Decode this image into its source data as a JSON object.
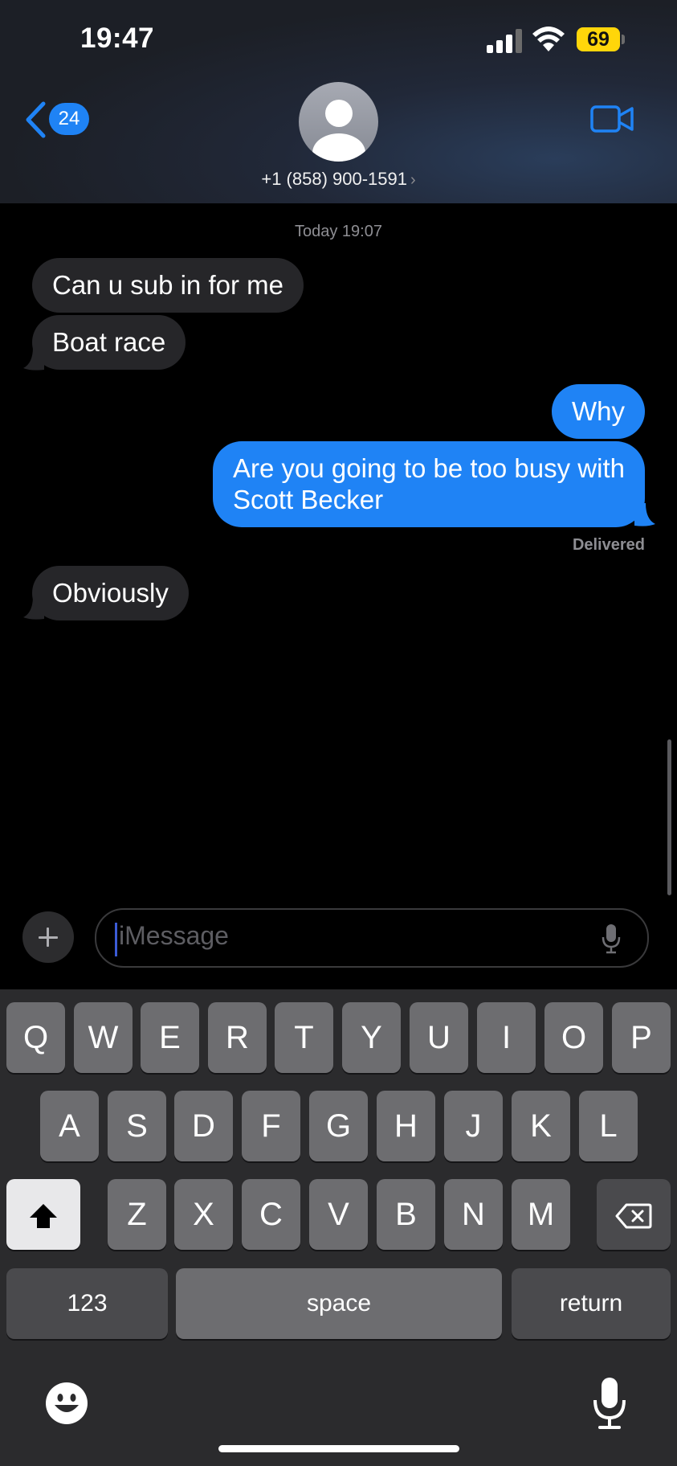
{
  "status_bar": {
    "time": "19:47",
    "battery": "69"
  },
  "nav": {
    "back_count": "24",
    "contact": "+1 (858) 900-1591",
    "chevron": "›"
  },
  "conversation": {
    "timestamp": "Today 19:07",
    "messages": [
      {
        "direction": "received",
        "text": "Can u sub in for me"
      },
      {
        "direction": "received",
        "text": "Boat race"
      },
      {
        "direction": "sent",
        "text": "Why"
      },
      {
        "direction": "sent",
        "text_line1": "Are you going to be too busy with",
        "text_line2": "Scott Becker"
      },
      {
        "direction": "received",
        "text": "Obviously"
      }
    ],
    "status": "Delivered"
  },
  "composer": {
    "placeholder": "iMessage"
  },
  "keyboard": {
    "row1": [
      "Q",
      "W",
      "E",
      "R",
      "T",
      "Y",
      "U",
      "I",
      "O",
      "P"
    ],
    "row2": [
      "A",
      "S",
      "D",
      "F",
      "G",
      "H",
      "J",
      "K",
      "L"
    ],
    "row3": [
      "Z",
      "X",
      "C",
      "V",
      "B",
      "N",
      "M"
    ],
    "numbers_label": "123",
    "space_label": "space",
    "return_label": "return"
  },
  "icons": [
    "back-chevron-icon",
    "avatar-icon",
    "video-camera-icon",
    "plus-icon",
    "microphone-icon",
    "shift-icon",
    "delete-icon",
    "emoji-icon",
    "dictation-icon"
  ],
  "colors": {
    "accent": "#1f83f5",
    "received_bubble": "#262629",
    "battery": "#ffd60a"
  }
}
